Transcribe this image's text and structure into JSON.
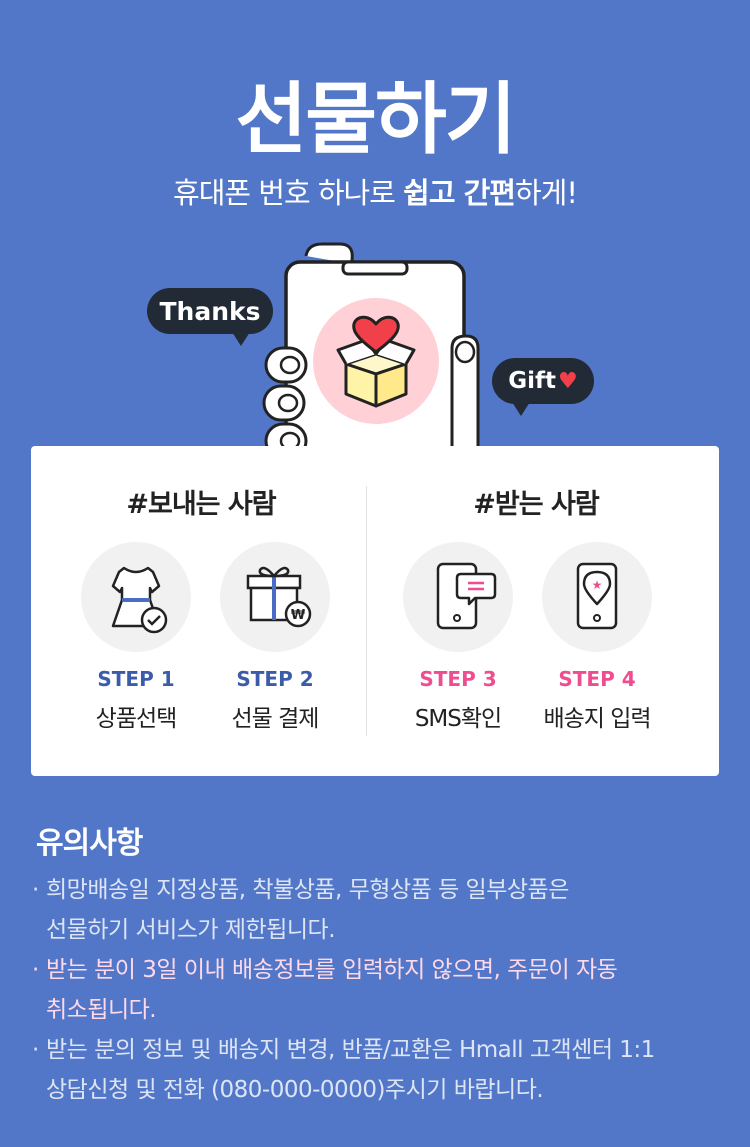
{
  "header": {
    "title": "선물하기",
    "subtitle_pre": "휴대폰 번호 하나로 ",
    "subtitle_strong": "쉽고 간편",
    "subtitle_post": "하게!"
  },
  "hero": {
    "bubble_left": "Thanks",
    "bubble_right": "Gift",
    "heart_glyph": "♥",
    "icon": "gift-box-heart-icon"
  },
  "sender": {
    "title": "#보내는 사람",
    "steps": [
      {
        "step": "STEP 1",
        "label": "상품선택",
        "icon": "dress-check-icon"
      },
      {
        "step": "STEP 2",
        "label": "선물 결제",
        "icon": "gift-won-icon"
      }
    ]
  },
  "receiver": {
    "title": "#받는 사람",
    "steps": [
      {
        "step": "STEP 3",
        "label": "SMS확인",
        "icon": "phone-message-icon"
      },
      {
        "step": "STEP 4",
        "label": "배송지 입력",
        "icon": "phone-location-icon"
      }
    ]
  },
  "notice": {
    "title": "유의사항",
    "bullet": "·",
    "items": [
      {
        "line1": "희망배송일 지정상품, 착불상품, 무형상품 등 일부상품은",
        "line2": "선물하기 서비스가 제한됩니다."
      },
      {
        "line1": "받는 분이 3일 이내 배송정보를 입력하지 않으면, 주문이 자동",
        "line2": "취소됩니다."
      },
      {
        "line1": "받는 분의 정보 및 배송지 변경, 반품/교환은 Hmall 고객센터 1:1",
        "line2": "상담신청 및 전화 (080-000-0000)주시기 바랍니다."
      }
    ]
  },
  "colors": {
    "background": "#5277c8",
    "step_blue": "#3b5ca8",
    "step_pink": "#ee4d8f",
    "bubble": "#222a36",
    "notice_highlight": "#ffd9ea"
  }
}
